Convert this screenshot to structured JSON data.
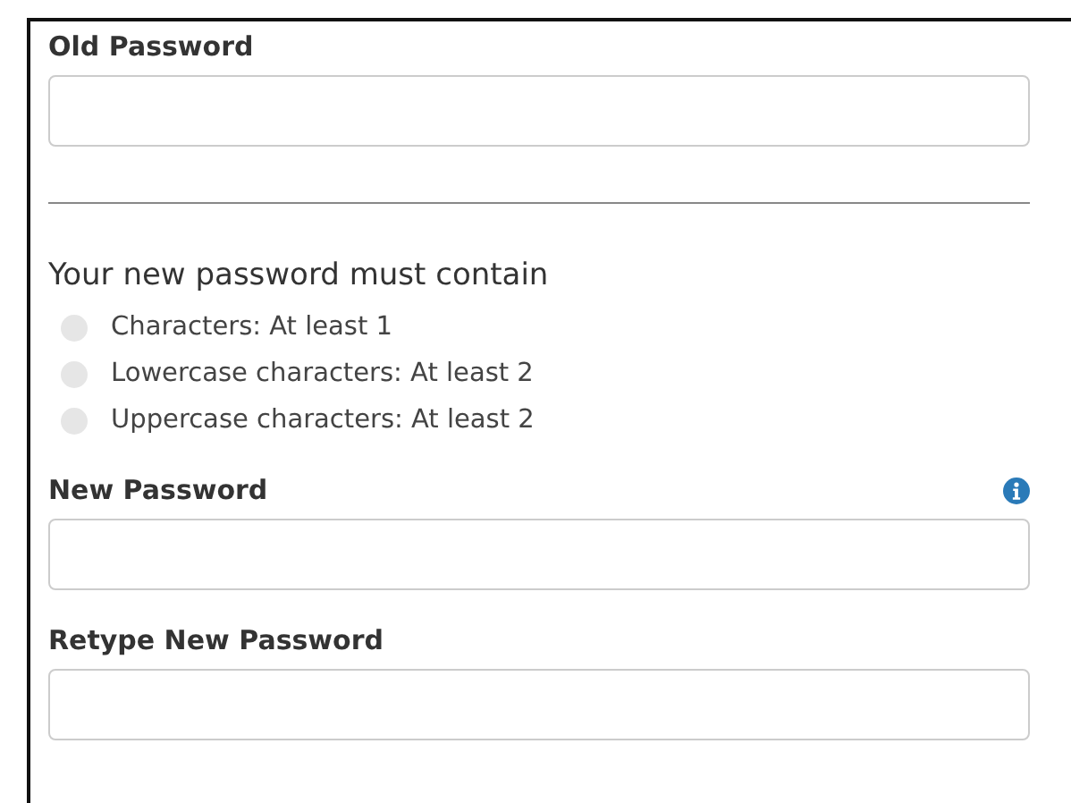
{
  "old_password": {
    "label": "Old Password"
  },
  "requirements": {
    "heading": "Your new password must contain",
    "items": [
      {
        "text": "Characters: At least 1",
        "met": false
      },
      {
        "text": "Lowercase characters: At least 2",
        "met": false
      },
      {
        "text": "Uppercase characters: At least 2",
        "met": false
      }
    ]
  },
  "new_password": {
    "label": "New Password",
    "info": true
  },
  "retype_password": {
    "label": "Retype New Password"
  }
}
